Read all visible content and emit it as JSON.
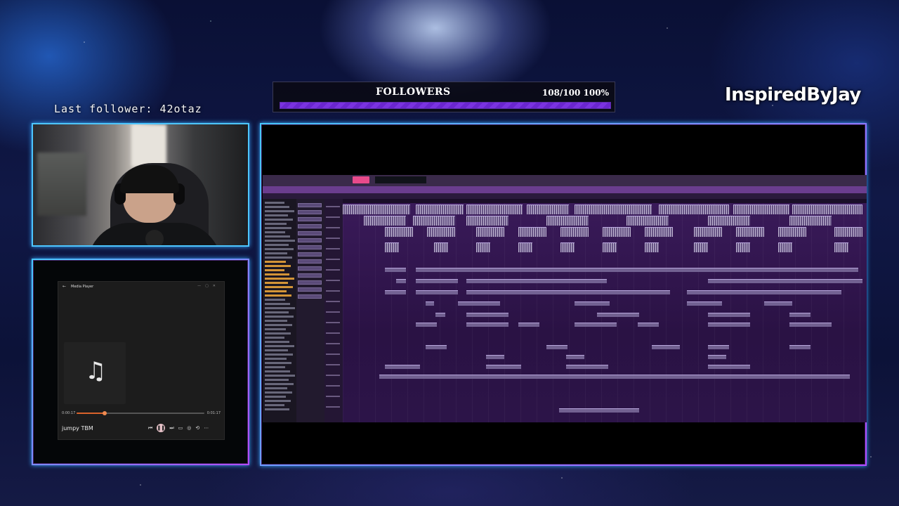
{
  "overlay": {
    "last_follower": "Last follower: 42otaz",
    "goal_title": "FOLLOWERS",
    "goal_count": "108/100 100%",
    "goal_progress": 1.0,
    "brand": "InspiredByJay",
    "frame_color": "#4dc6ff",
    "goal_fill_color": "#7a33e0"
  },
  "media_player": {
    "window_title": "Media Player",
    "time_elapsed": "0:00:17",
    "time_total": "0:01:17",
    "progress": 0.22,
    "track_name": "jumpy TBM",
    "art_icon": "music-note-icon",
    "accent_color": "#d9622b"
  },
  "daw": {
    "accent_color": "#6a3d8e"
  }
}
